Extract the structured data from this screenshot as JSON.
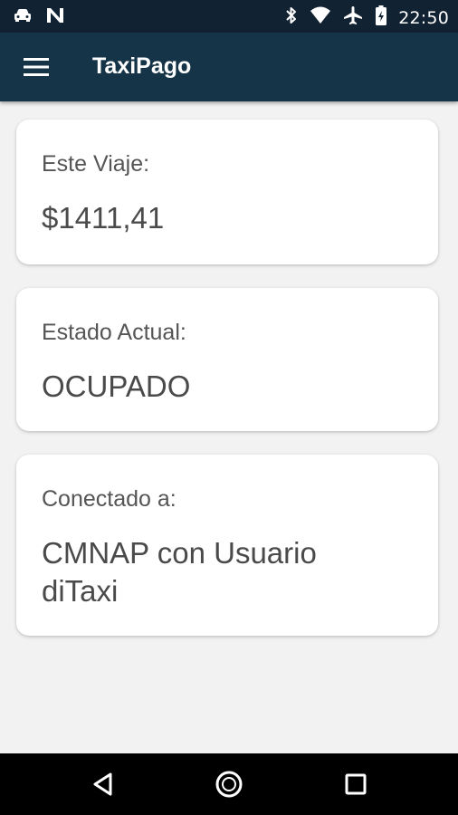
{
  "status_bar": {
    "time": "22:50",
    "icons": [
      "taxi-icon",
      "n-logo-icon",
      "bluetooth-icon",
      "wifi-icon",
      "airplane-mode-icon",
      "battery-charging-icon"
    ]
  },
  "app_bar": {
    "title": "TaxiPago",
    "menu_icon": "hamburger-menu-icon"
  },
  "cards": {
    "trip": {
      "label": "Este Viaje:",
      "value": "$1411,41"
    },
    "state": {
      "label": "Estado Actual:",
      "value": "OCUPADO"
    },
    "connection": {
      "label": "Conectado a:",
      "value": "CMNAP con Usuario diTaxi"
    }
  },
  "nav_bar": {
    "icons": [
      "back-icon",
      "home-icon",
      "recents-icon"
    ]
  },
  "colors": {
    "status_bar": "#112233",
    "app_bar": "#163448",
    "background": "#f2f2f2",
    "card": "#ffffff",
    "text": "#4a4a4a"
  }
}
